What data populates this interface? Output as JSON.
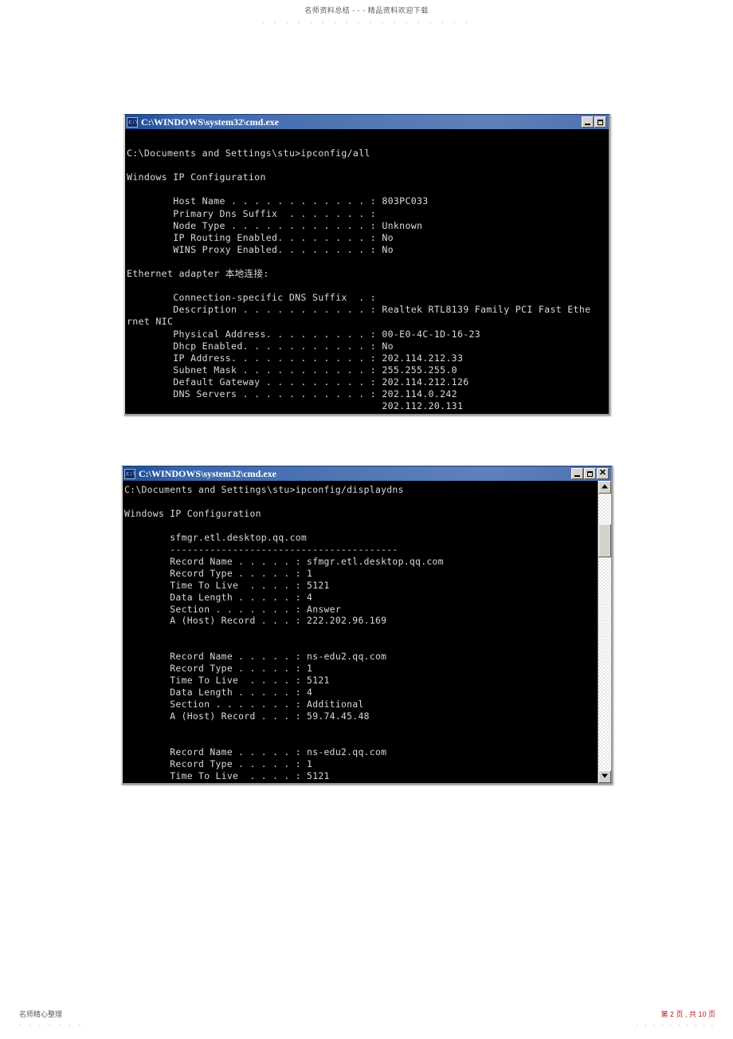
{
  "document": {
    "header_text": "名师资料总结 - - - 精品资料欢迎下载",
    "header_dots": ". . . . . . . . . . . . . . . . . .",
    "footer_left": "名师精心整理",
    "footer_left_dots": ". . . . . . .",
    "footer_right": "第 2 页 , 共 10 页",
    "footer_right_dots": ". . . . . . . . . ."
  },
  "windows": [
    {
      "id": "ipconfig-all",
      "title": "C:\\WINDOWS\\system32\\cmd.exe",
      "icon": "console-icon",
      "buttons": {
        "minimize": "_",
        "maximize": "□",
        "close": null
      },
      "has_scrollbar": false,
      "console_text": "\nC:\\Documents and Settings\\stu>ipconfig/all\n\nWindows IP Configuration\n\n        Host Name . . . . . . . . . . . . : 803PC033\n        Primary Dns Suffix  . . . . . . . :\n        Node Type . . . . . . . . . . . . : Unknown\n        IP Routing Enabled. . . . . . . . : No\n        WINS Proxy Enabled. . . . . . . . : No\n\nEthernet adapter 本地连接:\n\n        Connection-specific DNS Suffix  . :\n        Description . . . . . . . . . . . : Realtek RTL8139 Family PCI Fast Ethe\nrnet NIC\n        Physical Address. . . . . . . . . : 00-E0-4C-1D-16-23\n        Dhcp Enabled. . . . . . . . . . . : No\n        IP Address. . . . . . . . . . . . : 202.114.212.33\n        Subnet Mask . . . . . . . . . . . : 255.255.255.0\n        Default Gateway . . . . . . . . . : 202.114.212.126\n        DNS Servers . . . . . . . . . . . : 202.114.0.242\n                                            202.112.20.131"
    },
    {
      "id": "displaydns",
      "title": "C:\\WINDOWS\\system32\\cmd.exe",
      "icon": "console-icon",
      "buttons": {
        "minimize": "_",
        "maximize": "□",
        "close": "✕"
      },
      "has_scrollbar": true,
      "console_text": "C:\\Documents and Settings\\stu>ipconfig/displaydns\n\nWindows IP Configuration\n\n        sfmgr.etl.desktop.qq.com\n        ----------------------------------------\n        Record Name . . . . . : sfmgr.etl.desktop.qq.com\n        Record Type . . . . . : 1\n        Time To Live  . . . . : 5121\n        Data Length . . . . . : 4\n        Section . . . . . . . : Answer\n        A (Host) Record . . . : 222.202.96.169\n\n\n        Record Name . . . . . : ns-edu2.qq.com\n        Record Type . . . . . : 1\n        Time To Live  . . . . : 5121\n        Data Length . . . . . : 4\n        Section . . . . . . . : Additional\n        A (Host) Record . . . : 59.74.45.48\n\n\n        Record Name . . . . . : ns-edu2.qq.com\n        Record Type . . . . . : 1\n        Time To Live  . . . . : 5121"
    }
  ],
  "ipconfig_all_data": {
    "command": "ipconfig/all",
    "prompt": "C:\\Documents and Settings\\stu>",
    "section_title": "Windows IP Configuration",
    "host": {
      "Host Name": "803PC033",
      "Primary Dns Suffix": "",
      "Node Type": "Unknown",
      "IP Routing Enabled": "No",
      "WINS Proxy Enabled": "No"
    },
    "adapter_title": "Ethernet adapter 本地连接:",
    "adapter": {
      "Connection-specific DNS Suffix": "",
      "Description": "Realtek RTL8139 Family PCI Fast Ethernet NIC",
      "Physical Address": "00-E0-4C-1D-16-23",
      "Dhcp Enabled": "No",
      "IP Address": "202.114.212.33",
      "Subnet Mask": "255.255.255.0",
      "Default Gateway": "202.114.212.126",
      "DNS Servers": [
        "202.114.0.242",
        "202.112.20.131"
      ]
    }
  },
  "displaydns_data": {
    "command": "ipconfig/displaydns",
    "prompt": "C:\\Documents and Settings\\stu>",
    "section_title": "Windows IP Configuration",
    "records": [
      {
        "heading": "sfmgr.etl.desktop.qq.com",
        "Record Name": "sfmgr.etl.desktop.qq.com",
        "Record Type": "1",
        "Time To Live": "5121",
        "Data Length": "4",
        "Section": "Answer",
        "A (Host) Record": "222.202.96.169"
      },
      {
        "heading": "",
        "Record Name": "ns-edu2.qq.com",
        "Record Type": "1",
        "Time To Live": "5121",
        "Data Length": "4",
        "Section": "Additional",
        "A (Host) Record": "59.74.45.48"
      },
      {
        "heading": "",
        "Record Name": "ns-edu2.qq.com",
        "Record Type": "1",
        "Time To Live": "5121"
      }
    ]
  },
  "colors": {
    "titlebar_blue": "#4f76b4",
    "console_bg": "#000000",
    "console_fg": "#d9d9d9",
    "chrome_gray": "#d6d3ce",
    "footer_red": "#b02020"
  }
}
